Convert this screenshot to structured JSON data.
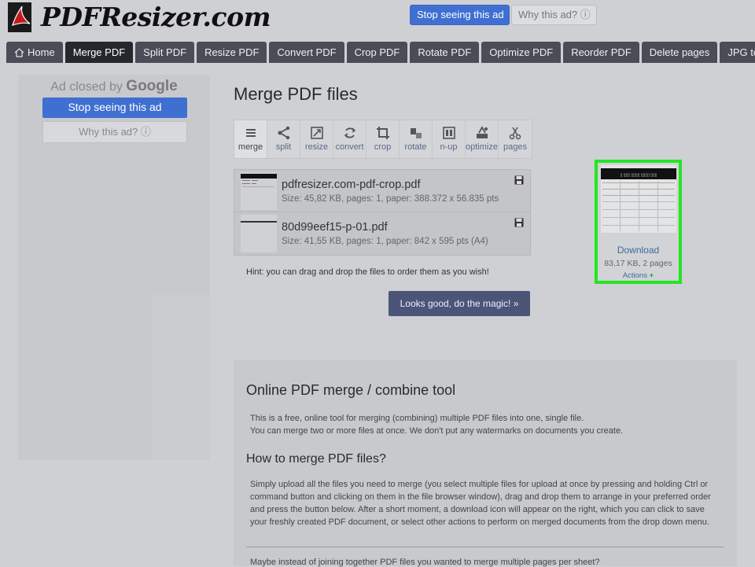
{
  "header": {
    "logo_text": "PDFResizer.com",
    "ad_stop": "Stop seeing this ad",
    "ad_why": "Why this ad? ⓘ"
  },
  "tabs": [
    {
      "label": "Home",
      "active": false
    },
    {
      "label": "Merge PDF",
      "active": true
    },
    {
      "label": "Split PDF",
      "active": false
    },
    {
      "label": "Resize PDF",
      "active": false
    },
    {
      "label": "Convert PDF",
      "active": false
    },
    {
      "label": "Crop PDF",
      "active": false
    },
    {
      "label": "Rotate PDF",
      "active": false
    },
    {
      "label": "Optimize PDF",
      "active": false
    },
    {
      "label": "Reorder PDF",
      "active": false
    },
    {
      "label": "Delete pages",
      "active": false
    },
    {
      "label": "JPG to PDF",
      "active": false
    }
  ],
  "left_ad": {
    "closed_prefix": "Ad closed by",
    "closed_brand": "Google",
    "stop": "Stop seeing this ad",
    "why": "Why this ad? ⓘ"
  },
  "page_title": "Merge PDF files",
  "tools": [
    {
      "label": "merge",
      "icon": "merge-icon",
      "active": true
    },
    {
      "label": "split",
      "icon": "split-icon",
      "active": false
    },
    {
      "label": "resize",
      "icon": "resize-icon",
      "active": false
    },
    {
      "label": "convert",
      "icon": "convert-icon",
      "active": false
    },
    {
      "label": "crop",
      "icon": "crop-icon",
      "active": false
    },
    {
      "label": "rotate",
      "icon": "rotate-icon",
      "active": false
    },
    {
      "label": "n-up",
      "icon": "n-up-icon",
      "active": false
    },
    {
      "label": "optimize",
      "icon": "optimize-icon",
      "active": false
    },
    {
      "label": "pages",
      "icon": "scissors-icon",
      "active": false
    }
  ],
  "files": [
    {
      "name": "pdfresizer.com-pdf-crop.pdf",
      "meta": "Size: 45,82 KB, pages: 1, paper: 388.372 x 56.835 pts"
    },
    {
      "name": "80d99eef15-p-01.pdf",
      "meta": "Size: 41,55 KB, pages: 1, paper: 842 x 595 pts (A4)"
    }
  ],
  "hint": "Hint: you can drag and drop the files to order them as you wish!",
  "magic_button": "Looks good, do the magic! »",
  "result": {
    "download": "Download",
    "meta": "83,17 KB, 2 pages",
    "actions": "Actions",
    "actions_icon": "+"
  },
  "info": {
    "title": "Online PDF merge / combine tool",
    "p1_line1": "This is a free, online tool for merging (combining) multiple PDF files into one, single file.",
    "p1_line2": "You can merge two or more files at once. We don't put any watermarks on documents you create.",
    "subtitle": "How to merge PDF files?",
    "p2": "Simply upload all the files you need to merge (you select multiple files for upload at once by pressing and holding Ctrl or command button and clicking on them in the file browser window), drag and drop them to arrange in your preferred order and press the button below. After a short moment, a download icon will appear on the right, which you can click to save your freshly created PDF document, or select other actions to perform on merged documents from the drop down menu.",
    "p3": "Maybe instead of joining together PDF files you wanted to merge multiple pages per sheet?"
  },
  "colors": {
    "ad_blue": "#3f6fd1",
    "tab_dark": "#4a4c57",
    "tab_active": "#26272c",
    "highlight_green": "#22e622",
    "button_navy": "#4a5578"
  }
}
